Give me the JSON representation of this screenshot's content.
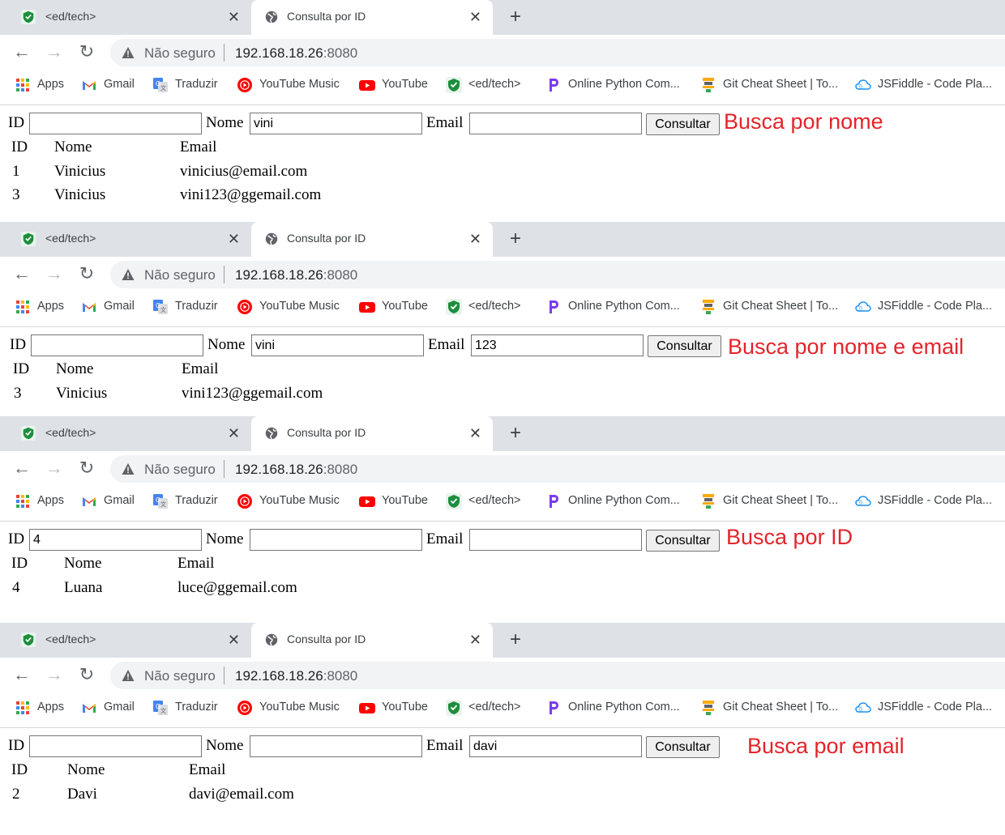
{
  "browser": {
    "inactive_tab": {
      "title": "<ed/tech>",
      "close": "✕"
    },
    "active_tab": {
      "title": "Consulta por ID",
      "close": "✕"
    },
    "new_tab": "+",
    "nav": {
      "back": "←",
      "forward": "→",
      "reload": "↻"
    },
    "omnibox": {
      "insecure": "Não seguro",
      "host": "192.168.18.26",
      "port": ":8080"
    },
    "bookmarks": [
      "Apps",
      "Gmail",
      "Traduzir",
      "YouTube Music",
      "YouTube",
      "<ed/tech>",
      "Online Python Com...",
      "Git Cheat Sheet | To...",
      "JSFiddle - Code Pla..."
    ]
  },
  "colors": {
    "annotation": "#e3242b",
    "tabstrip": "#dee1e6",
    "omnibox": "#f1f3f4"
  },
  "form_labels": {
    "id": "ID",
    "nome": "Nome",
    "email": "Email",
    "button": "Consultar"
  },
  "table_headers": [
    "ID",
    "Nome",
    "Email"
  ],
  "panels": [
    {
      "inputs": {
        "id": "",
        "nome": "vini",
        "email": ""
      },
      "annotation": "Busca por nome",
      "rows": [
        [
          "1",
          "Vinicius",
          "vinicius@email.com"
        ],
        [
          "3",
          "Vinicius",
          "vini123@ggemail.com"
        ]
      ]
    },
    {
      "inputs": {
        "id": "",
        "nome": "vini",
        "email": "123"
      },
      "annotation": "Busca por nome e email",
      "rows": [
        [
          "3",
          "Vinicius",
          "vini123@ggemail.com"
        ]
      ]
    },
    {
      "inputs": {
        "id": "4",
        "nome": "",
        "email": ""
      },
      "annotation": "Busca por ID",
      "rows": [
        [
          "4",
          "Luana",
          "luce@ggemail.com"
        ]
      ]
    },
    {
      "inputs": {
        "id": "",
        "nome": "",
        "email": "davi"
      },
      "annotation": "Busca por email",
      "rows": [
        [
          "2",
          "Davi",
          "davi@email.com"
        ]
      ]
    }
  ]
}
